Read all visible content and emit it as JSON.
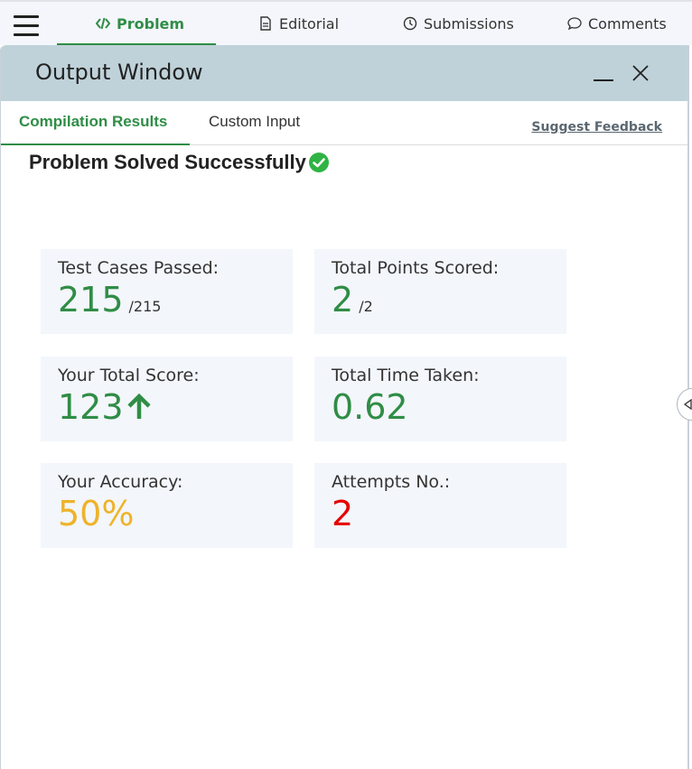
{
  "nav": {
    "tabs": [
      {
        "label": "Problem",
        "icon": "code-icon"
      },
      {
        "label": "Editorial",
        "icon": "document-icon"
      },
      {
        "label": "Submissions",
        "icon": "clock-icon"
      },
      {
        "label": "Comments",
        "icon": "comment-icon"
      }
    ],
    "active_color": "#2f8d46"
  },
  "output_window": {
    "title": "Output Window",
    "tabs": [
      {
        "label": "Compilation Results"
      },
      {
        "label": "Custom Input"
      }
    ],
    "feedback_link": "Suggest Feedback",
    "status": "Problem Solved Successfully",
    "cards": {
      "test_cases": {
        "label": "Test Cases Passed:",
        "value": "215",
        "suffix": "/215"
      },
      "points": {
        "label": "Total Points Scored:",
        "value": "2",
        "suffix": "/2"
      },
      "score": {
        "label": "Your Total Score:",
        "value": "123"
      },
      "time": {
        "label": "Total Time Taken:",
        "value": "0.62"
      },
      "accuracy": {
        "label": "Your Accuracy:",
        "value": "50%"
      },
      "attempts": {
        "label": "Attempts No.:",
        "value": "2"
      }
    }
  },
  "colors": {
    "green": "#2f8d46",
    "amber": "#eeb32a",
    "red": "#e60000",
    "header_bg": "#bfd2d9",
    "card_bg": "#f3f6fb"
  }
}
